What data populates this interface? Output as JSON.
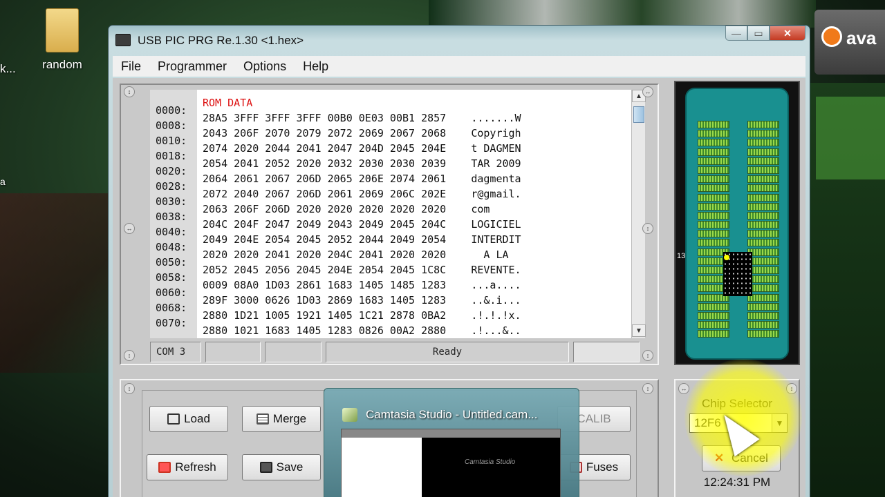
{
  "desktop": {
    "icon_label": "random",
    "side_text_1": "k...",
    "side_text_2": "a"
  },
  "avast": {
    "label": "ava"
  },
  "window": {
    "title": "USB PIC PRG Re.1.30   <1.hex>",
    "buttons": {
      "minimize": "—",
      "maximize": "▭",
      "close": "✕"
    }
  },
  "menu": [
    "File",
    "Programmer",
    "Options",
    "Help"
  ],
  "hex": {
    "header": "ROM DATA",
    "addresses": "0000:\n0008:\n0010:\n0018:\n0020:\n0028:\n0030:\n0038:\n0040:\n0048:\n0050:\n0058:\n0060:\n0068:\n0070:",
    "rows": "28A5 3FFF 3FFF 3FFF 00B0 0E03 00B1 2857    .......W\n2043 206F 2070 2079 2072 2069 2067 2068    Copyrigh\n2074 2020 2044 2041 2047 204D 2045 204E    t DAGMEN\n2054 2041 2052 2020 2032 2030 2030 2039    TAR 2009\n2064 2061 2067 206D 2065 206E 2074 2061    dagmenta\n2072 2040 2067 206D 2061 2069 206C 202E    r@gmail.\n2063 206F 206D 2020 2020 2020 2020 2020    com\n204C 204F 2047 2049 2043 2049 2045 204C    LOGICIEL\n2049 204E 2054 2045 2052 2044 2049 2054    INTERDIT\n2020 2020 2041 2020 204C 2041 2020 2020      A LA\n2052 2045 2056 2045 204E 2054 2045 1C8C    REVENTE.\n0009 08A0 1D03 2861 1683 1405 1485 1283    ...a....\n289F 3000 0626 1D03 2869 1683 1405 1283    ..&.i...\n2880 1D21 1005 1921 1405 1C21 2878 0BA2    .!.!.!x.\n2880 1021 1683 1405 1283 0826 00A2 2880    .!...&.."
  },
  "status": {
    "port": "COM 3",
    "cell2": "",
    "cell3": "",
    "state": "Ready"
  },
  "chip_panel": {
    "pin_label": "13"
  },
  "buttons": {
    "load": "Load",
    "merge": "Merge",
    "calib": "CALIB",
    "refresh": "Refresh",
    "save": "Save",
    "fuses": "Fuses"
  },
  "chip_selector": {
    "label": "Chip Selector",
    "value": "12F6",
    "cancel": "Cancel",
    "time": "12:24:31 PM"
  },
  "thumbnail": {
    "title": "Camtasia Studio - Untitled.cam...",
    "logo": "Camtasia Studio"
  }
}
